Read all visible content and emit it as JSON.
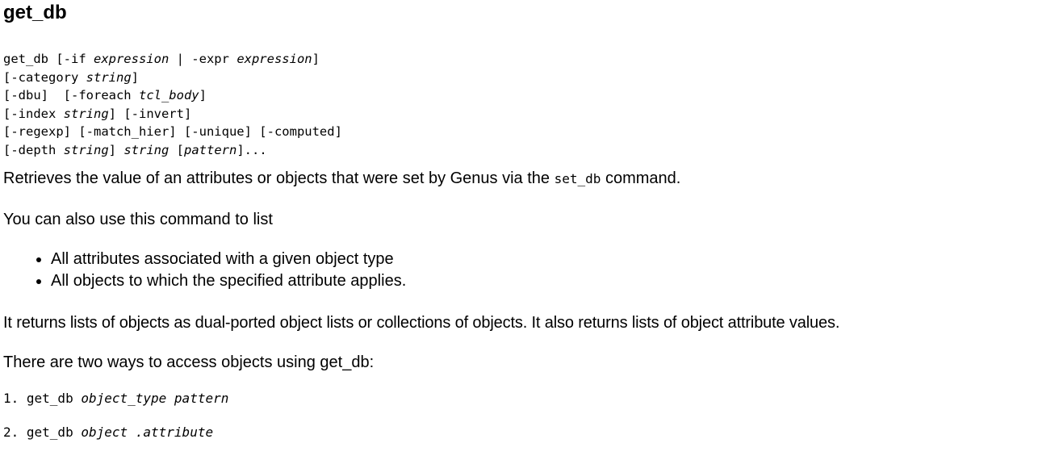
{
  "page": {
    "title": "get_db"
  },
  "synopsis": {
    "l1": {
      "a": "get_db [-if ",
      "b": "expression",
      "c": " | -expr ",
      "d": "expression",
      "e": "]"
    },
    "l2": {
      "a": "[-category ",
      "b": "string",
      "c": "]"
    },
    "l3": {
      "a": "[-dbu]  [-foreach ",
      "b": "tcl_body",
      "c": "]"
    },
    "l4": {
      "a": "[-index ",
      "b": "string",
      "c": "] [-invert]"
    },
    "l5": {
      "a": "[-regexp] [-match_hier] [-unique] [-computed]"
    },
    "l6": {
      "a": "[-depth ",
      "b": "string",
      "c": "] ",
      "d": "string",
      "e": " [",
      "f": "pattern",
      "g": "]..."
    }
  },
  "description": {
    "retrieves_pre": "Retrieves the value of an attributes or objects that were set by Genus via the ",
    "retrieves_code": "set_db",
    "retrieves_post": " command.",
    "list_intro": "You can also use this command to list",
    "bullets": [
      "All attributes associated with a given object type",
      "All objects to which the specified attribute applies."
    ],
    "returns": "It returns lists of objects as dual-ported object lists or collections of objects. It also returns lists of object attribute values.",
    "ways_intro": "There are two ways to access objects using get_db:"
  },
  "usage": {
    "item1": {
      "prefix": "1. get_db ",
      "args": "object_type pattern"
    },
    "item2": {
      "prefix": "2. get_db ",
      "args": "object .attribute"
    }
  }
}
